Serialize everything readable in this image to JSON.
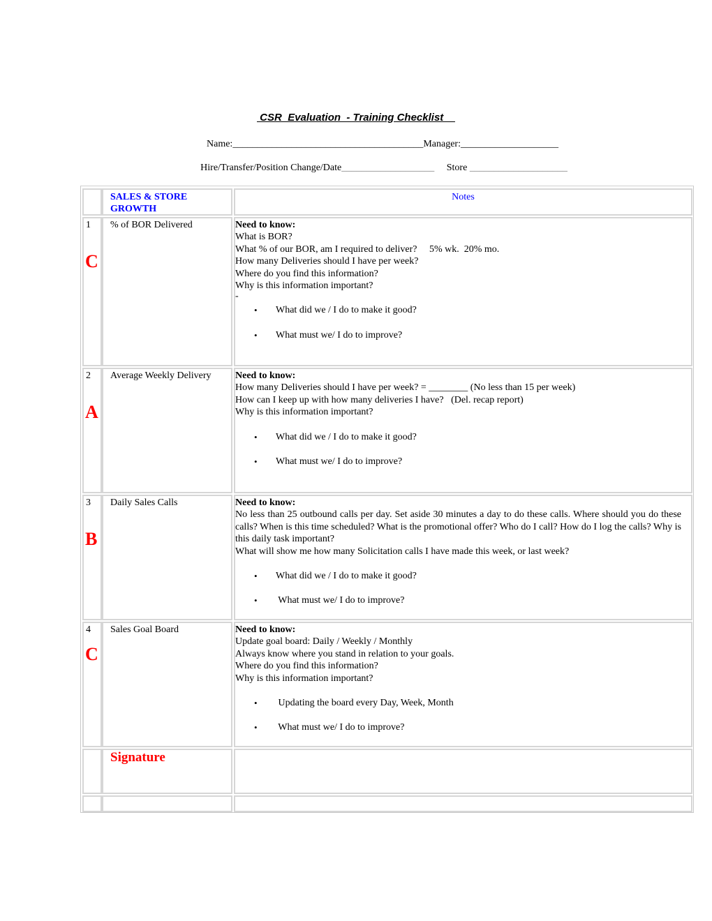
{
  "header": {
    "title": " CSR  Evaluation  - Training Checklist    ",
    "name_label": "Name:",
    "name_blank": "_______________________________________",
    "manager_label": "Manager:",
    "manager_blank": "____________________",
    "hire_label": "Hire/Transfer/Position Change/Date",
    "hire_blank": "___________________",
    "store_label": "Store",
    "store_blank": "____________________"
  },
  "table": {
    "section_header": "SALES & STORE GROWTH",
    "notes_header": "Notes",
    "rows": [
      {
        "number": "1",
        "grade": "C",
        "topic": "% of BOR Delivered",
        "need_label": "Need to know:",
        "lines": [
          "What is BOR?",
          "What % of our BOR, am I required to deliver?     5% wk.  20% mo.",
          "How many Deliveries should I have per week?",
          "Where do you find this information?",
          "Why is this information important?"
        ],
        "dash": "-",
        "bullets": [
          "What did we / I do to make it good?",
          "What must we/ I do to improve?"
        ]
      },
      {
        "number": "2",
        "grade": "A",
        "topic": "Average Weekly Delivery",
        "need_label": "Need to know:",
        "lines": [
          "How many Deliveries should I have per week? = ________ (No less than 15 per week)",
          "How can I keep up with how many deliveries I have?   (Del. recap report)",
          "Why is this information important?"
        ],
        "bullets": [
          "What did we / I do to make it good?",
          "What must we/ I do to improve?"
        ]
      },
      {
        "number": "3",
        "grade": "B",
        "topic": "Daily Sales Calls",
        "need_label": "Need to know:",
        "lines": [
          "No less than 25 outbound calls per day. Set aside 30 minutes a day to do these calls. Where should you do these calls?  When is this time scheduled? What is the promotional offer? Who do I call? How do I log the calls? Why is this daily task important?",
          "What will show me how many Solicitation calls I have made this week, or last week?"
        ],
        "bullets": [
          "What did we / I do to make it good?",
          " What must we/ I do to improve?"
        ]
      },
      {
        "number": "4",
        "grade": "C",
        "topic": "Sales Goal Board",
        "need_label": "Need to know:",
        "lines": [
          "Update goal board: Daily / Weekly / Monthly",
          "Always know where you stand in relation to your goals.",
          "Where do you find this information?",
          "Why is this information important?"
        ],
        "bullets": [
          " Updating the board every Day, Week, Month",
          " What must we/ I do to improve?"
        ]
      }
    ],
    "signature_label": "Signature"
  }
}
